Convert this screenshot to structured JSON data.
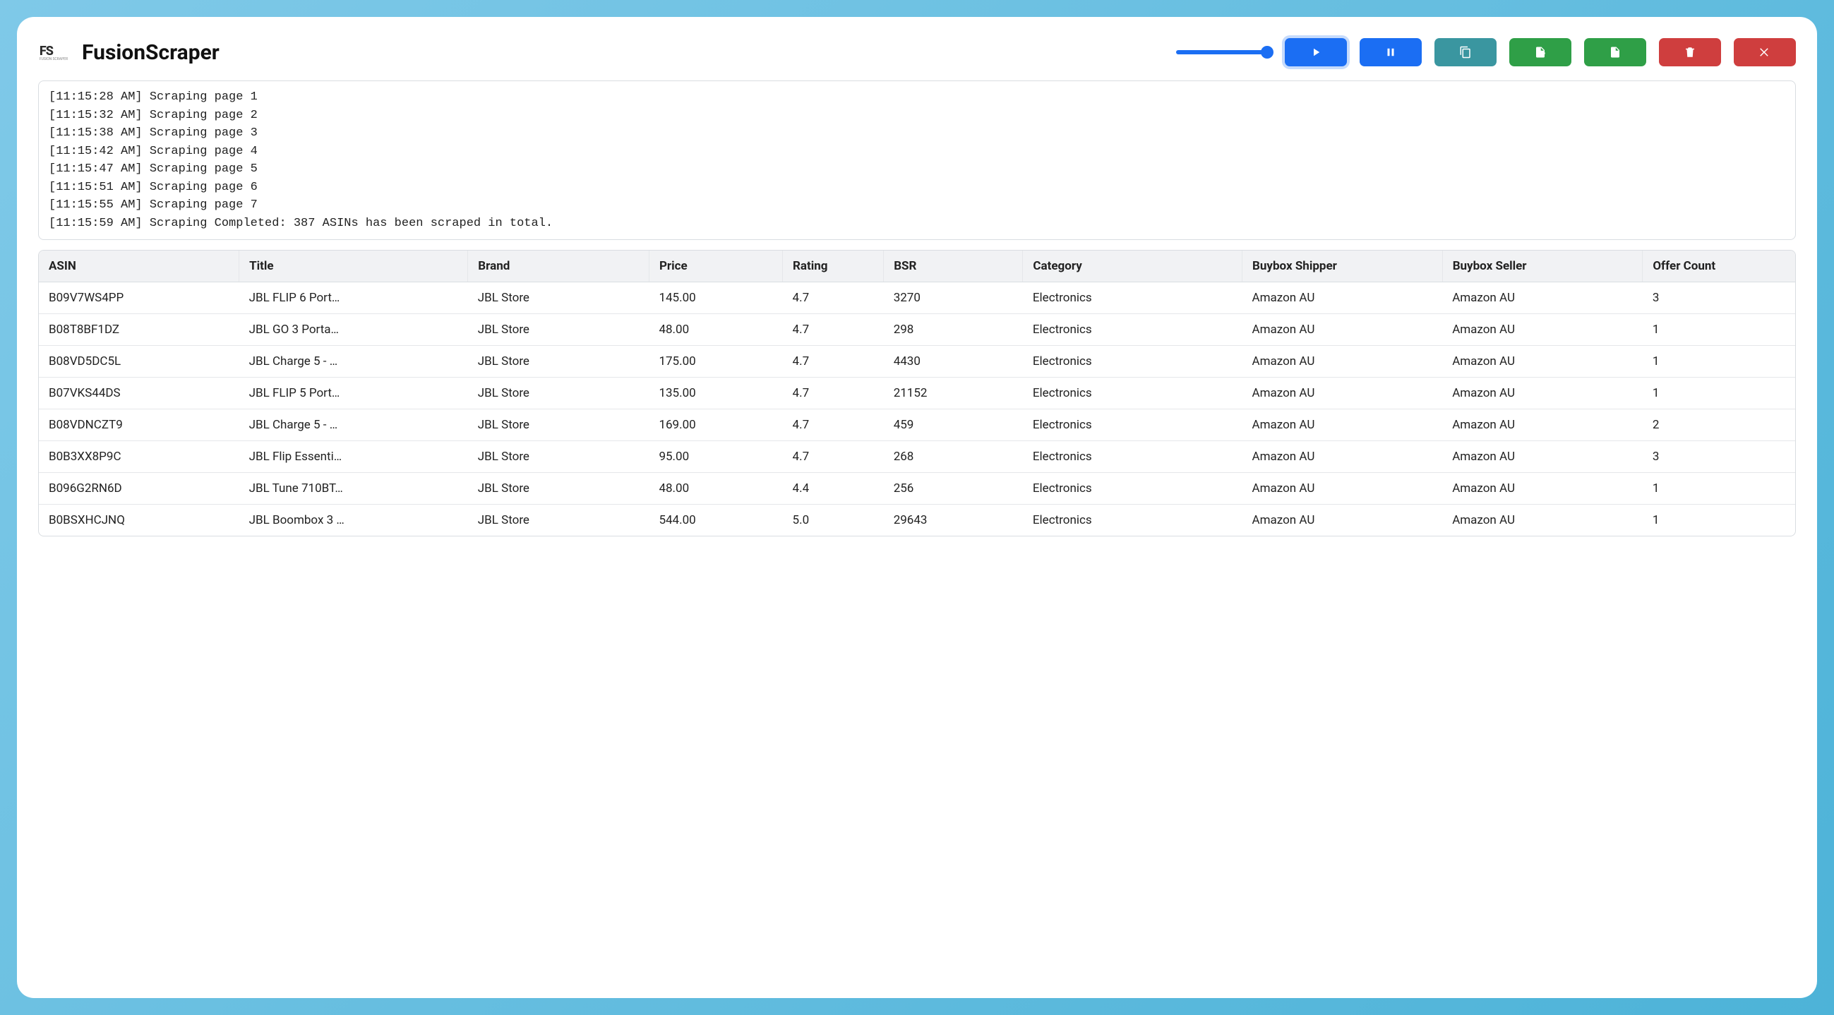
{
  "app": {
    "title": "FusionScraper",
    "logo_mark": "FS",
    "logo_sub": "FUSION SCRAPER"
  },
  "toolbar": {
    "slider_value": 100,
    "buttons": {
      "play": {
        "icon": "play"
      },
      "pause": {
        "icon": "pause"
      },
      "copy": {
        "icon": "copy"
      },
      "csv": {
        "icon": "file-csv"
      },
      "xls": {
        "icon": "file-xls"
      },
      "trash": {
        "icon": "trash"
      },
      "close": {
        "icon": "close"
      }
    }
  },
  "log": {
    "lines": [
      "[11:15:28 AM] Scraping page 1",
      "[11:15:32 AM] Scraping page 2",
      "[11:15:38 AM] Scraping page 3",
      "[11:15:42 AM] Scraping page 4",
      "[11:15:47 AM] Scraping page 5",
      "[11:15:51 AM] Scraping page 6",
      "[11:15:55 AM] Scraping page 7",
      "[11:15:59 AM] Scraping Completed: 387 ASINs has been scraped in total."
    ]
  },
  "table": {
    "columns": [
      "ASIN",
      "Title",
      "Brand",
      "Price",
      "Rating",
      "BSR",
      "Category",
      "Buybox Shipper",
      "Buybox Seller",
      "Offer Count"
    ],
    "rows": [
      {
        "asin": "B09V7WS4PP",
        "title": "JBL FLIP 6 Port…",
        "brand": "JBL Store",
        "price": "145.00",
        "rating": "4.7",
        "bsr": "3270",
        "category": "Electronics",
        "shipper": "Amazon AU",
        "seller": "Amazon AU",
        "offers": "3"
      },
      {
        "asin": "B08T8BF1DZ",
        "title": "JBL GO 3 Porta…",
        "brand": "JBL Store",
        "price": "48.00",
        "rating": "4.7",
        "bsr": "298",
        "category": "Electronics",
        "shipper": "Amazon AU",
        "seller": "Amazon AU",
        "offers": "1"
      },
      {
        "asin": "B08VD5DC5L",
        "title": "JBL Charge 5 - …",
        "brand": "JBL Store",
        "price": "175.00",
        "rating": "4.7",
        "bsr": "4430",
        "category": "Electronics",
        "shipper": "Amazon AU",
        "seller": "Amazon AU",
        "offers": "1"
      },
      {
        "asin": "B07VKS44DS",
        "title": "JBL FLIP 5 Port…",
        "brand": "JBL Store",
        "price": "135.00",
        "rating": "4.7",
        "bsr": "21152",
        "category": "Electronics",
        "shipper": "Amazon AU",
        "seller": "Amazon AU",
        "offers": "1"
      },
      {
        "asin": "B08VDNCZT9",
        "title": "JBL Charge 5 - …",
        "brand": "JBL Store",
        "price": "169.00",
        "rating": "4.7",
        "bsr": "459",
        "category": "Electronics",
        "shipper": "Amazon AU",
        "seller": "Amazon AU",
        "offers": "2"
      },
      {
        "asin": "B0B3XX8P9C",
        "title": "JBL Flip Essenti…",
        "brand": "JBL Store",
        "price": "95.00",
        "rating": "4.7",
        "bsr": "268",
        "category": "Electronics",
        "shipper": "Amazon AU",
        "seller": "Amazon AU",
        "offers": "3"
      },
      {
        "asin": "B096G2RN6D",
        "title": "JBL Tune 710BT…",
        "brand": "JBL Store",
        "price": "48.00",
        "rating": "4.4",
        "bsr": "256",
        "category": "Electronics",
        "shipper": "Amazon AU",
        "seller": "Amazon AU",
        "offers": "1"
      },
      {
        "asin": "B0BSXHCJNQ",
        "title": "JBL Boombox 3 …",
        "brand": "JBL Store",
        "price": "544.00",
        "rating": "5.0",
        "bsr": "29643",
        "category": "Electronics",
        "shipper": "Amazon AU",
        "seller": "Amazon AU",
        "offers": "1"
      }
    ]
  }
}
